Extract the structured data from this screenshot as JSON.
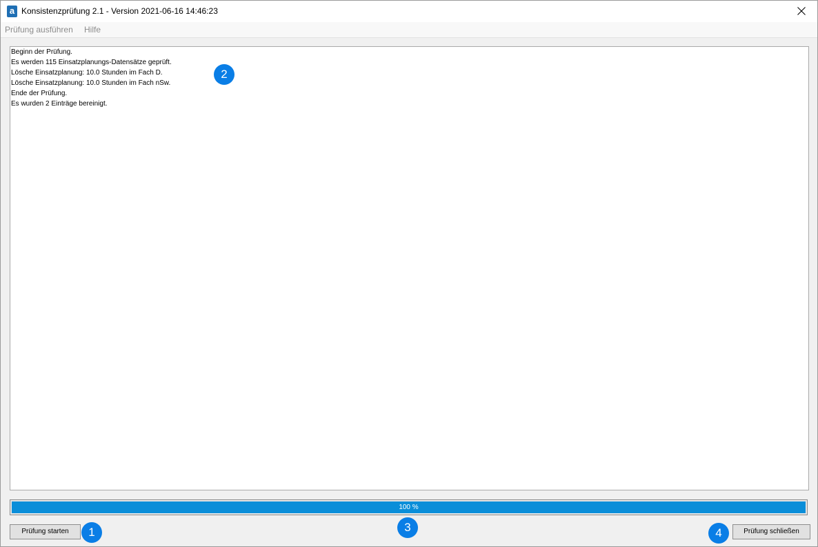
{
  "window": {
    "title": "Konsistenzprüfung 2.1 - Version 2021-06-16 14:46:23",
    "app_icon": "app-logo-icon",
    "app_icon_letter": "a",
    "close_icon": "close-icon"
  },
  "menu": {
    "items": [
      "Prüfung ausführen",
      "Hilfe"
    ]
  },
  "log": {
    "lines": [
      "Beginn der Prüfung.",
      "Es werden 115 Einsatzplanungs-Datensätze geprüft.",
      "Lösche Einsatzplanung: 10.0 Stunden im Fach D.",
      "Lösche Einsatzplanung: 10.0 Stunden im Fach nSw.",
      "Ende der Prüfung.",
      "Es wurden 2 Einträge bereinigt."
    ]
  },
  "progress": {
    "value": 100,
    "label": "100 %",
    "color": "#0a8ed9"
  },
  "buttons": {
    "start_label": "Prüfung starten",
    "close_label": "Prüfung schließen"
  },
  "badges": [
    "1",
    "2",
    "3",
    "4"
  ],
  "colors": {
    "badge": "#0a7ee6",
    "progress_fill": "#0a8ed9"
  }
}
